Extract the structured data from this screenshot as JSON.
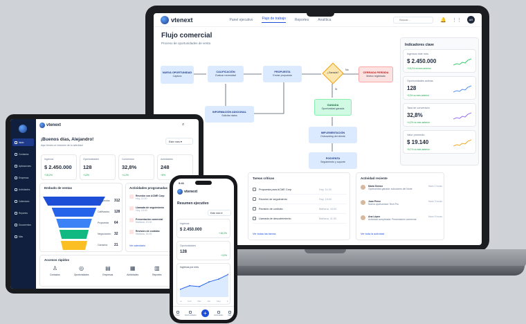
{
  "brand": "vtenext",
  "laptop": {
    "nav": [
      "Panel ejecutivo",
      "Flujo de trabajo",
      "Reportes",
      "Analítica"
    ],
    "search_placeholder": "Buscar...",
    "avatar": "AR",
    "title": "Flujo comercial",
    "subtitle": "Proceso de oportunidades de venta",
    "flow": {
      "n1_title": "NUEVA OPORTUNIDAD",
      "n1_sub": "Captura",
      "n2_title": "CALIFICACIÓN",
      "n2_sub": "Evaluar necesidad",
      "n3_title": "PROPUESTA",
      "n3_sub": "Enviar propuesta",
      "decision": "¿Ganada?",
      "no": "No",
      "si": "Sí",
      "n4_title": "CERRADA PERDIDA",
      "n4_sub": "Motivo registrado",
      "n5_title": "INFORMACIÓN ADICIONAL",
      "n5_sub": "Solicitar datos",
      "n6_title": "GANADA",
      "n6_sub": "Oportunidad ganada",
      "n7_title": "IMPLEMENTACIÓN",
      "n7_sub": "Onboarding del cliente",
      "n8_title": "POSVENTA",
      "n8_sub": "Seguimiento y soporte"
    },
    "kpi_title": "Indicadores clave",
    "kpis": [
      {
        "label": "Ingresos este mes",
        "value": "$ 2.450.000",
        "change": "+18,2% vs mes anterior"
      },
      {
        "label": "Oportunidades activas",
        "value": "128",
        "change": "+12% vs mes anterior"
      },
      {
        "label": "Tasa de conversión",
        "value": "32,8%",
        "change": "+4,2% vs mes anterior"
      },
      {
        "label": "Valor promedio",
        "value": "$ 19.140",
        "change": "+6,7% vs mes anterior"
      }
    ],
    "tasks_title": "Tareas críticas",
    "tasks": [
      {
        "name": "Propuesta para ACME Corp",
        "date": "Hoy, 11:00"
      },
      {
        "name": "Reunión de seguimiento",
        "date": "Hoy, 15:00"
      },
      {
        "name": "Revisión de contrato",
        "date": "Mañana, 10:00"
      },
      {
        "name": "Llamada de descubrimiento",
        "date": "Mañana, 11:30"
      }
    ],
    "tasks_link": "Ver todas las tareas",
    "activity_title": "Actividad reciente",
    "activity": [
      {
        "name": "María Gómez",
        "desc": "Oportunidad ganada: soluciones del Norte",
        "time": "Hace 2 horas"
      },
      {
        "name": "Juan Pérez",
        "desc": "Nueva oportunidad: Tech Pro",
        "time": "Hace 3 horas"
      },
      {
        "name": "Ana López",
        "desc": "Actividad completada: Presentación comercial",
        "time": "Hace 5 horas"
      }
    ],
    "activity_link": "Ver toda la actividad"
  },
  "tablet": {
    "greeting": "¡Buenos días, Alejandro!",
    "greeting_sub": "Aquí tienes un resumen de tu actividad",
    "period": "Este mes",
    "sidebar": [
      "Inicio",
      "Contactos",
      "Aplicaciones",
      "Empresas",
      "Actividades",
      "Calendario",
      "Reportes",
      "Documentos",
      "Más"
    ],
    "kpis": [
      {
        "label": "Ingresos",
        "value": "$ 2.450.000",
        "change": "+18,2%"
      },
      {
        "label": "Oportunidades",
        "value": "128",
        "change": "+12%"
      },
      {
        "label": "Conversión",
        "value": "32,8%",
        "change": "+4,2%"
      },
      {
        "label": "Actividades",
        "value": "248",
        "change": "+8%"
      }
    ],
    "funnel_title": "Embudo de ventas",
    "funnel": [
      {
        "stage": "Prospectos",
        "value": "312"
      },
      {
        "stage": "Calificados",
        "value": "128"
      },
      {
        "stage": "Propuesta",
        "value": "64"
      },
      {
        "stage": "Negociación",
        "value": "32"
      },
      {
        "stage": "Ganados",
        "value": "21"
      }
    ],
    "acts_title": "Actividades programadas",
    "acts": [
      {
        "name": "Reunión con ACME Corp",
        "time": "Hoy, 11:00"
      },
      {
        "name": "Llamada de seguimiento",
        "time": "Hoy, 15:00"
      },
      {
        "name": "Presentación comercial",
        "time": "Mañana, 10:00"
      },
      {
        "name": "Revisión de contrato",
        "time": "Mañana, 14:00"
      }
    ],
    "acts_link": "Ver calendario",
    "quick_title": "Accesos rápidos",
    "quick": [
      "Contactos",
      "Oportunidades",
      "Empresas",
      "Actividades",
      "Reportes",
      "Documentos"
    ]
  },
  "phone": {
    "time": "9:41",
    "title": "Resumen ejecutivo",
    "period": "Este mes",
    "kpi1_label": "Ingresos",
    "kpi1_value": "$ 2.450.000",
    "kpi1_change": "+18,2%",
    "kpi2_label": "Oportunidades",
    "kpi2_value": "128",
    "kpi2_change": "+12%",
    "chart_title": "Ingresos por mes",
    "tabs": [
      "Inicio",
      "Oportunidades",
      "",
      "Actividades",
      "Más"
    ]
  },
  "chart_data": {
    "type": "area",
    "categories": [
      "Ene",
      "Feb",
      "Mar",
      "Abr",
      "May",
      "Jun"
    ],
    "values": [
      0.8,
      1.2,
      1.1,
      1.6,
      1.9,
      2.4
    ]
  }
}
